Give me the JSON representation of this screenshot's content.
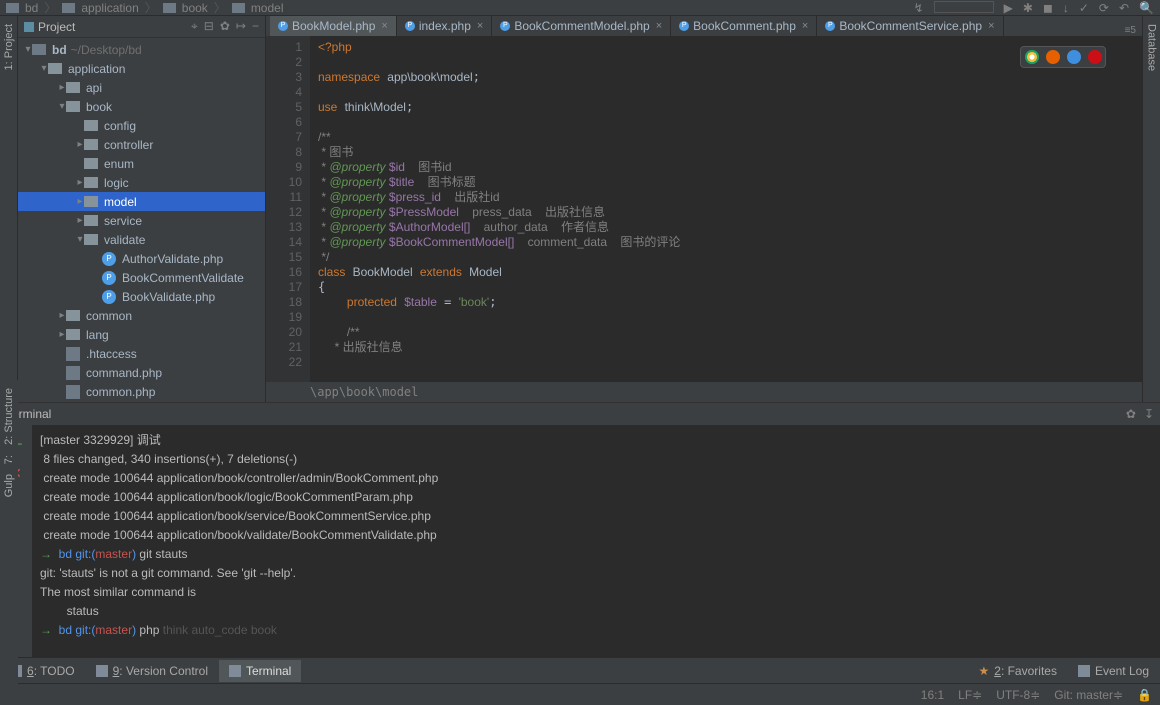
{
  "breadcrumb": [
    "bd",
    "application",
    "book",
    "model"
  ],
  "project": {
    "title": "Project",
    "root": {
      "name": "bd",
      "sub": "~/Desktop/bd"
    },
    "tree": [
      {
        "name": "application",
        "d": 0,
        "open": true,
        "kind": "folder"
      },
      {
        "name": "api",
        "d": 1,
        "open": false,
        "kind": "folder"
      },
      {
        "name": "book",
        "d": 1,
        "open": true,
        "kind": "folder"
      },
      {
        "name": "config",
        "d": 2,
        "open": null,
        "kind": "folder"
      },
      {
        "name": "controller",
        "d": 2,
        "open": false,
        "kind": "folder"
      },
      {
        "name": "enum",
        "d": 2,
        "open": null,
        "kind": "folder"
      },
      {
        "name": "logic",
        "d": 2,
        "open": false,
        "kind": "folder"
      },
      {
        "name": "model",
        "d": 2,
        "open": false,
        "kind": "folder",
        "sel": true
      },
      {
        "name": "service",
        "d": 2,
        "open": false,
        "kind": "folder"
      },
      {
        "name": "validate",
        "d": 2,
        "open": true,
        "kind": "folder"
      },
      {
        "name": "AuthorValidate.php",
        "d": 3,
        "kind": "php"
      },
      {
        "name": "BookCommentValidate",
        "d": 3,
        "kind": "php"
      },
      {
        "name": "BookValidate.php",
        "d": 3,
        "kind": "php"
      },
      {
        "name": "common",
        "d": 1,
        "open": false,
        "kind": "folder"
      },
      {
        "name": "lang",
        "d": 1,
        "open": false,
        "kind": "folder"
      },
      {
        "name": ".htaccess",
        "d": 1,
        "kind": "file"
      },
      {
        "name": "command.php",
        "d": 1,
        "kind": "file"
      },
      {
        "name": "common.php",
        "d": 1,
        "kind": "file"
      }
    ]
  },
  "tabs": [
    {
      "label": "BookModel.php",
      "active": true
    },
    {
      "label": "index.php"
    },
    {
      "label": "BookCommentModel.php"
    },
    {
      "label": "BookComment.php"
    },
    {
      "label": "BookCommentService.php"
    }
  ],
  "tabs_end": "≡5",
  "code_lines": 22,
  "code_html": "<span class='k'>&lt;?php</span>\n\n<span class='k'>namespace</span> <span class='n'>app\\book\\model</span>;\n\n<span class='k'>use</span> <span class='n'>think\\Model</span>;\n\n<span class='c'>/**</span>\n<span class='c'> * 图书</span>\n<span class='c'> * </span><span class='d'>@property</span><span class='c'> </span><span class='v'>$id</span><span class='c'>    图书id</span>\n<span class='c'> * </span><span class='d'>@property</span><span class='c'> </span><span class='v'>$title</span><span class='c'>    图书标题</span>\n<span class='c'> * </span><span class='d'>@property</span><span class='c'> </span><span class='v'>$press_id</span><span class='c'>    出版社id</span>\n<span class='c'> * </span><span class='d'>@property</span><span class='c'> </span><span class='v'>$PressModel</span><span class='c'>    press_data    出版社信息</span>\n<span class='c'> * </span><span class='d'>@property</span><span class='c'> </span><span class='v'>$AuthorModel[]</span><span class='c'>    author_data    作者信息</span>\n<span class='c'> * </span><span class='d'>@property</span><span class='c'> </span><span class='v'>$BookCommentModel[]</span><span class='c'>    comment_data    图书的评论</span>\n<span class='c'> */</span>\n<span class='k'>class</span> <span class='cl'>BookModel</span> <span class='k'>extends</span> <span class='cl'>Model</span>\n{\n    <span class='k'>protected</span> <span class='v'>$table</span> = <span class='s'>'book'</span>;\n\n    <span class='c'>/**</span>\n<span class='c'>     * 出版社信息</span>",
  "code_crumb": "\\app\\book\\model",
  "browsers": {
    "chrome": "#f4c042",
    "firefox": "#e66000",
    "safari": "#3f8fde",
    "opera": "#cc0f16"
  },
  "terminal": {
    "title": "Terminal",
    "lines": [
      "[master 3329929] 调试",
      " 8 files changed, 340 insertions(+), 7 deletions(-)",
      " create mode 100644 application/book/controller/admin/BookComment.php",
      " create mode 100644 application/book/logic/BookCommentParam.php",
      " create mode 100644 application/book/service/BookCommentService.php",
      " create mode 100644 application/book/validate/BookCommentValidate.php"
    ],
    "prompt1": {
      "dir": "bd",
      "git": "git:(",
      "branch": "master",
      "paren": ")",
      "cmd": "git stauts"
    },
    "err1": "git: 'stauts' is not a git command. See 'git --help'.",
    "hint1": "The most similar command is",
    "hint2": "        status",
    "prompt2": {
      "dir": "bd",
      "git": "git:(",
      "branch": "master",
      "paren": ")",
      "cmd": "php ",
      "ghost": "think auto_code book"
    }
  },
  "bottom_tabs": [
    {
      "label": "6: TODO",
      "u": "6",
      "icon": "todo"
    },
    {
      "label": "9: Version Control",
      "u": "9",
      "icon": "vcs"
    },
    {
      "label": "Terminal",
      "icon": "term",
      "active": true
    }
  ],
  "right_bottom": [
    {
      "label": "2: Favorites",
      "icon": "star",
      "star": true
    },
    {
      "label": "Event Log",
      "icon": "log"
    }
  ],
  "left_tools": [
    "1: Project"
  ],
  "left_tools2": [
    "2: Structure",
    "7:",
    "Gulp"
  ],
  "right_tools": [
    "Database"
  ],
  "status": {
    "pos": "16:1",
    "eol": "LF",
    "enc": "UTF-8",
    "git": "Git: master"
  }
}
